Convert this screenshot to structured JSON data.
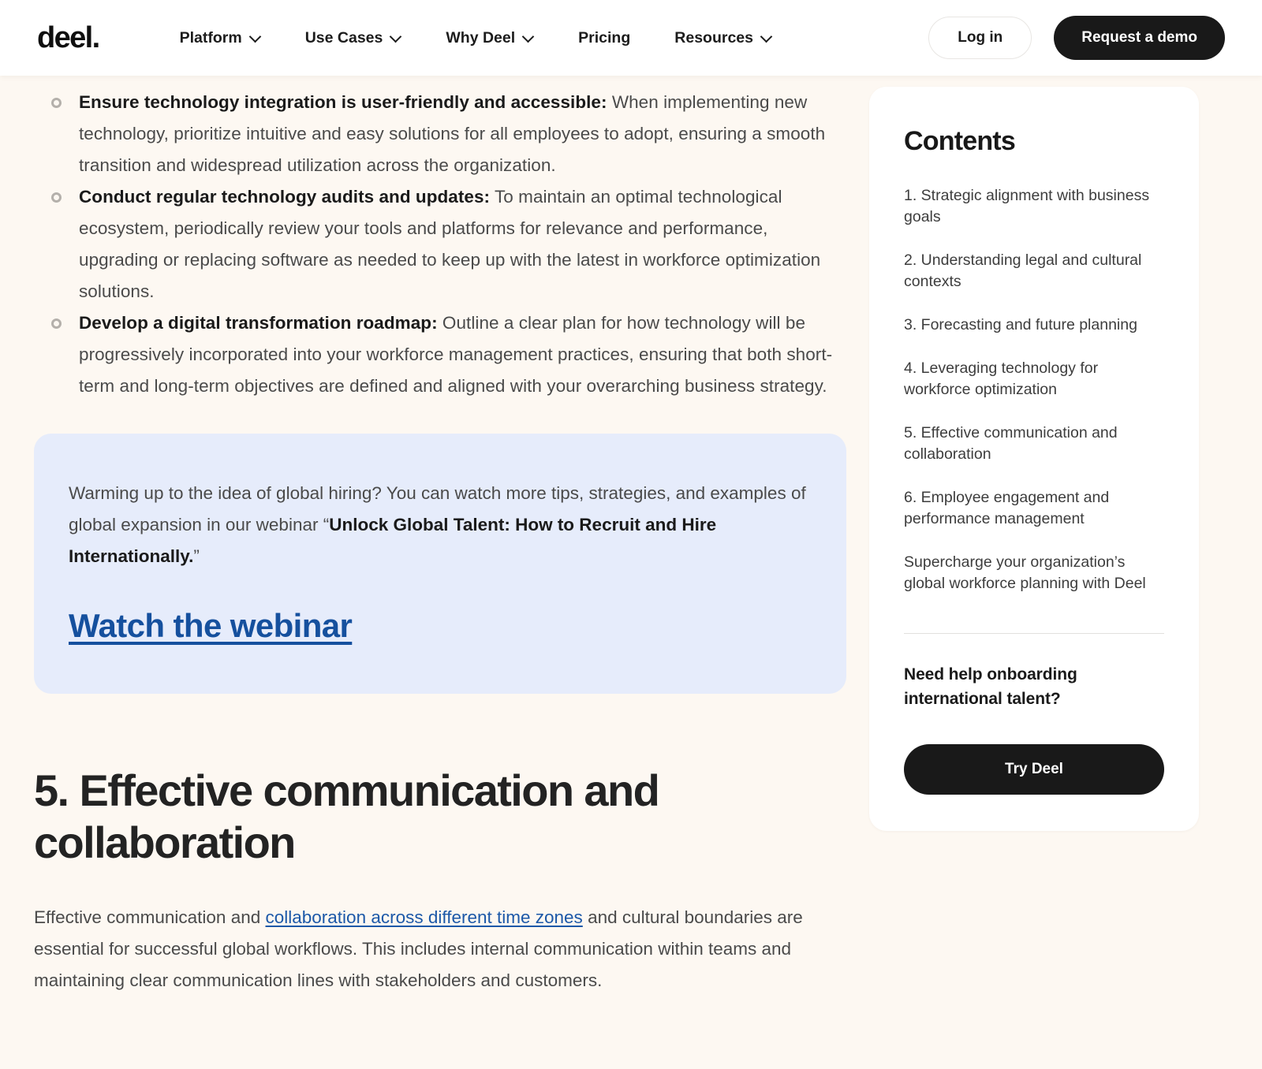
{
  "nav": {
    "logo": "deel.",
    "items": [
      {
        "label": "Platform",
        "has_chevron": true,
        "icon": "chevron-down-icon"
      },
      {
        "label": "Use Cases",
        "has_chevron": true,
        "icon": "chevron-down-icon"
      },
      {
        "label": "Why Deel",
        "has_chevron": true,
        "icon": "chevron-down-icon"
      },
      {
        "label": "Pricing",
        "has_chevron": false,
        "icon": ""
      },
      {
        "label": "Resources",
        "has_chevron": true,
        "icon": "chevron-down-icon"
      }
    ],
    "login_label": "Log in",
    "demo_label": "Request a demo"
  },
  "article": {
    "bullets": [
      {
        "marker": "ring-bullet-icon",
        "lead": "Ensure technology integration is user-friendly and accessible:",
        "body": " When implementing new technology, prioritize intuitive and easy solutions for all employees to adopt, ensuring a smooth transition and widespread utilization across the organization."
      },
      {
        "marker": "ring-bullet-icon",
        "lead": "Conduct regular technology audits and updates:",
        "body": " To maintain an optimal technological ecosystem, periodically review your tools and platforms for relevance and performance, upgrading or replacing software as needed to keep up with the latest in workforce optimization solutions."
      },
      {
        "marker": "ring-bullet-icon",
        "lead": "Develop a digital transformation roadmap:",
        "body": " Outline a clear plan for how technology will be progressively incorporated into your workforce management practices, ensuring that both short-term and long-term objectives are defined and aligned with your overarching business strategy."
      }
    ],
    "callout": {
      "text_before": "Warming up to the idea of global hiring? You can watch more tips, strategies, and examples of global expansion in our webinar “",
      "webinar_title": "Unlock Global Talent: How to Recruit and Hire Internationally.",
      "text_after": "”",
      "link_label": "Watch the webinar"
    },
    "section": {
      "heading": "5. Effective communication and collaboration",
      "paragraph_before": "Effective communication and ",
      "paragraph_link": "collaboration across different time zones",
      "paragraph_after": " and cultural boundaries are essential for successful global workflows. This includes internal communication within teams and maintaining clear communication lines with stakeholders and customers."
    }
  },
  "sidebar": {
    "title": "Contents",
    "items": [
      "1. Strategic alignment with business goals",
      "2. Understanding legal and cultural contexts",
      "3. Forecasting and future planning",
      "4. Leveraging technology for workforce optimization",
      "5. Effective communication and collaboration",
      "6. Employee engagement and performance management",
      "Supercharge your organization’s global workforce planning with Deel"
    ],
    "cta_text": "Need help onboarding international talent?",
    "cta_button": "Try Deel"
  },
  "colors": {
    "page_background": "#fdf8f2",
    "callout_background": "#e6ecfb",
    "link_blue": "#15509e",
    "inline_link_blue": "#1c58a8",
    "dark_button": "#191919",
    "card_white": "#ffffff"
  }
}
